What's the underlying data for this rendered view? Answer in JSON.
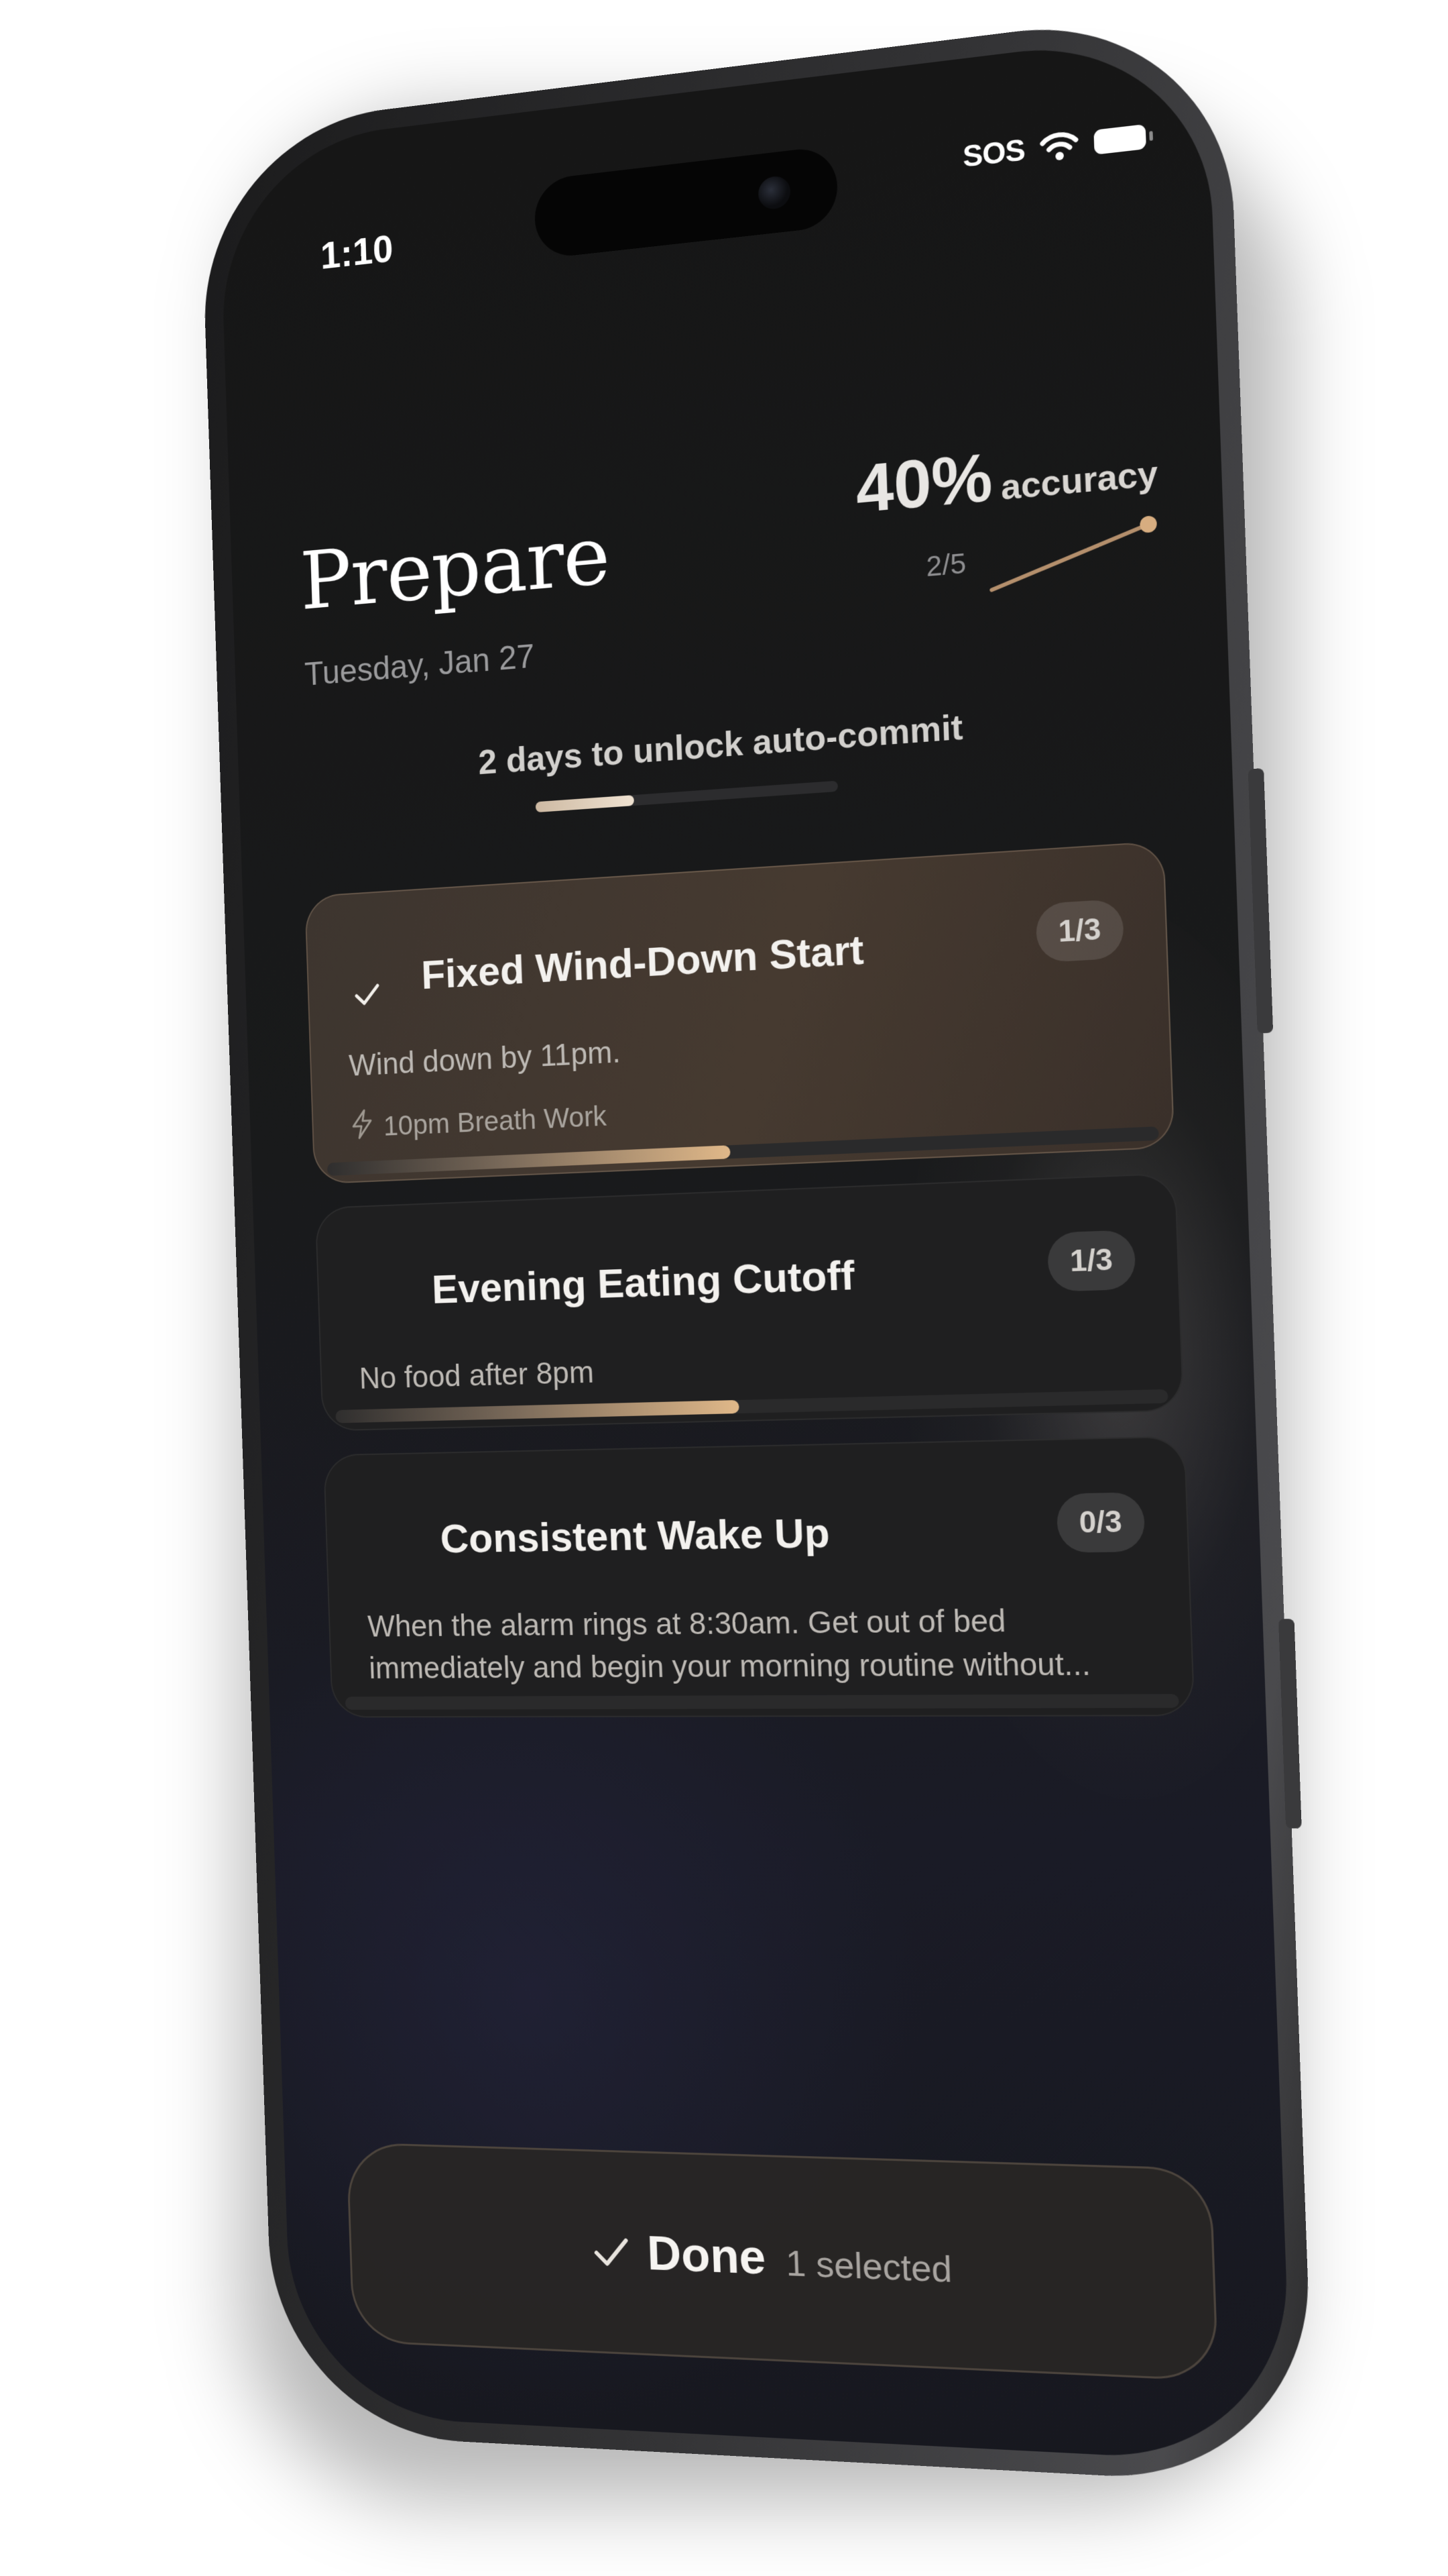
{
  "status_bar": {
    "time": "1:10",
    "sos": "SOS"
  },
  "header": {
    "title": "Prepare",
    "date": "Tuesday, Jan 27"
  },
  "accuracy": {
    "value": "40%",
    "label": "accuracy",
    "ratio": "2/5"
  },
  "unlock": {
    "text": "2 days to unlock auto-commit",
    "progress": 0.33
  },
  "habits": [
    {
      "title": "Fixed Wind-Down Start",
      "count": "1/3",
      "description": "Wind down by 11pm.",
      "sub": "10pm Breath Work",
      "selected": true,
      "progress": 0.5
    },
    {
      "title": "Evening Eating Cutoff",
      "count": "1/3",
      "description": "No food after 8pm",
      "selected": false,
      "progress": 0.5
    },
    {
      "title": "Consistent Wake Up",
      "count": "0/3",
      "description": "When the alarm rings at 8:30am. Get out of bed immediately and begin your morning routine without...",
      "selected": false,
      "progress": 0
    }
  ],
  "done": {
    "label": "Done",
    "count": "1 selected"
  },
  "colors": {
    "accent": "#e0b889",
    "selected_card": "#463a30",
    "background": "#191a1b"
  }
}
